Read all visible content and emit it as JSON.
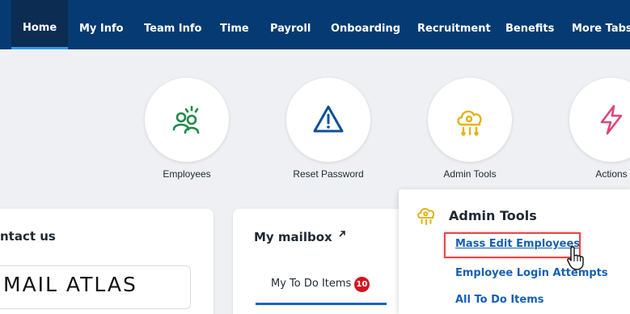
{
  "nav": {
    "tabs": [
      {
        "label": "Home",
        "active": true
      },
      {
        "label": "My Info"
      },
      {
        "label": "Team Info"
      },
      {
        "label": "Time"
      },
      {
        "label": "Payroll"
      },
      {
        "label": "Onboarding"
      },
      {
        "label": "Recruitment"
      },
      {
        "label": "Benefits"
      },
      {
        "label": "More Tabs ("
      }
    ]
  },
  "quick_access": [
    {
      "label": "Employees",
      "icon": "employees-icon"
    },
    {
      "label": "Reset Password",
      "icon": "warning-triangle-icon"
    },
    {
      "label": "Admin Tools",
      "icon": "cloud-gear-icon"
    },
    {
      "label": "Actions",
      "icon": "lightning-icon"
    }
  ],
  "contact": {
    "title": "ntact us",
    "logo_text": "MAIL ATLAS"
  },
  "mailbox": {
    "title": "My mailbox",
    "external_icon": "external-link-icon",
    "tab_label": "My To Do Items",
    "badge_count": "10"
  },
  "admin_menu": {
    "title": "Admin Tools",
    "icon": "cloud-gear-icon",
    "items": [
      "Mass Edit Employees",
      "Employee Login Attempts",
      "All To Do Items"
    ]
  },
  "colors": {
    "nav_bg": "#063a73",
    "active_tab_bg": "#0c2c52",
    "link": "#1660b3",
    "highlight": "#e14a4a",
    "badge": "#d3131f"
  }
}
